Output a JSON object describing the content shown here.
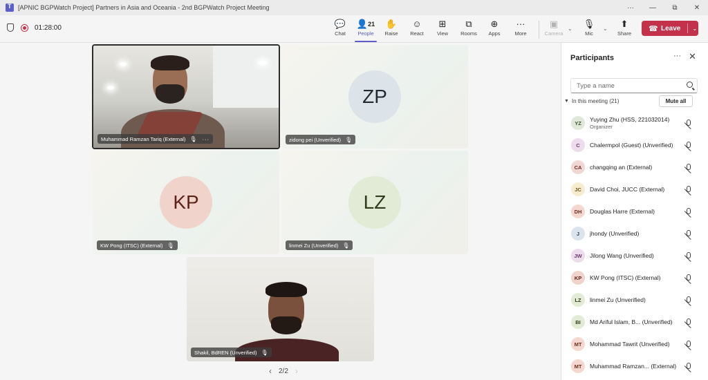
{
  "window": {
    "title": "[APNIC BGPWatch Project] Partners in Asia and Oceania - 2nd BGPWatch Project Meeting",
    "controls": [
      "···",
      "—",
      "⧉",
      "✕"
    ]
  },
  "toolbar": {
    "timer": "01:28:00",
    "buttons": [
      {
        "label": "Chat",
        "icon": "chat-icon",
        "glyph": "💬"
      },
      {
        "label": "People",
        "icon": "people-icon",
        "glyph": "👤",
        "count": "21"
      },
      {
        "label": "Raise",
        "icon": "raise-hand-icon",
        "glyph": "✋"
      },
      {
        "label": "React",
        "icon": "react-icon",
        "glyph": "☺"
      },
      {
        "label": "View",
        "icon": "view-icon",
        "glyph": "⊞"
      },
      {
        "label": "Rooms",
        "icon": "rooms-icon",
        "glyph": "⧉"
      },
      {
        "label": "Apps",
        "icon": "apps-icon",
        "glyph": "⊕"
      },
      {
        "label": "More",
        "icon": "more-icon",
        "glyph": "···"
      },
      {
        "label": "Camera",
        "icon": "camera-off-icon",
        "glyph": "▣"
      },
      {
        "label": "Mic",
        "icon": "mic-off-icon",
        "glyph": "🎙"
      },
      {
        "label": "Share",
        "icon": "share-icon",
        "glyph": "⬆"
      }
    ],
    "leave_label": "Leave"
  },
  "stage": {
    "tiles": [
      {
        "name": "Muhammad Ramzan Tariq (External)",
        "type": "video"
      },
      {
        "name": "zidong pei (Unverified)",
        "type": "avatar",
        "initials": "ZP",
        "bg": "#dce4ea",
        "fg": "#1f2a33"
      },
      {
        "name": "KW Pong (ITSC) (External)",
        "type": "avatar",
        "initials": "KP",
        "bg": "#f0d4cb",
        "fg": "#5c2418"
      },
      {
        "name": "linmei Zu (Unverified)",
        "type": "avatar",
        "initials": "LZ",
        "bg": "#e2ebd5",
        "fg": "#2e3c1c"
      },
      {
        "name": "Shakil, BdREN (Unverified)",
        "type": "video"
      }
    ],
    "pager": "2/2"
  },
  "panel": {
    "title": "Participants",
    "search_placeholder": "Type a name",
    "section_label": "In this meeting (21)",
    "mute_all_label": "Mute all",
    "participants": [
      {
        "initials": "YZ",
        "name": "Yuying Zhu (HSS, 221032014)",
        "sub": "Organizer",
        "bg": "#dfe8d9",
        "fg": "#3b5230"
      },
      {
        "initials": "C",
        "name": "Chalermpol (Guest) (Unverified)",
        "bg": "#ecdcec",
        "fg": "#6b3b6b"
      },
      {
        "initials": "CA",
        "name": "changqing an (External)",
        "bg": "#f0d7d3",
        "fg": "#6e2a23"
      },
      {
        "initials": "JC",
        "name": "David Choi, JUCC (External)",
        "bg": "#f7ecd0",
        "fg": "#6e5319"
      },
      {
        "initials": "DH",
        "name": "Douglas Harre (External)",
        "bg": "#f4d8cf",
        "fg": "#6b2e1e"
      },
      {
        "initials": "J",
        "name": "jhondy (Unverified)",
        "bg": "#dbe4ec",
        "fg": "#2e4150"
      },
      {
        "initials": "JW",
        "name": "Jilong Wang (Unverified)",
        "bg": "#ecdcec",
        "fg": "#6b3b6b"
      },
      {
        "initials": "KP",
        "name": "KW Pong (ITSC) (External)",
        "bg": "#f0d4cb",
        "fg": "#5c2418"
      },
      {
        "initials": "LZ",
        "name": "linmei Zu (Unverified)",
        "bg": "#e2ebd5",
        "fg": "#2e3c1c"
      },
      {
        "initials": "BI",
        "name": "Md Ariful Islam, B...   (Unverified)",
        "bg": "#e2ebd5",
        "fg": "#2e3c1c"
      },
      {
        "initials": "MT",
        "name": "Mohammad Tawrit (Unverified)",
        "bg": "#f4d8cf",
        "fg": "#6b2e1e"
      },
      {
        "initials": "MT",
        "name": "Muhammad Ramzan...  (External)",
        "bg": "#f4d8cf",
        "fg": "#6b2e1e"
      }
    ]
  }
}
